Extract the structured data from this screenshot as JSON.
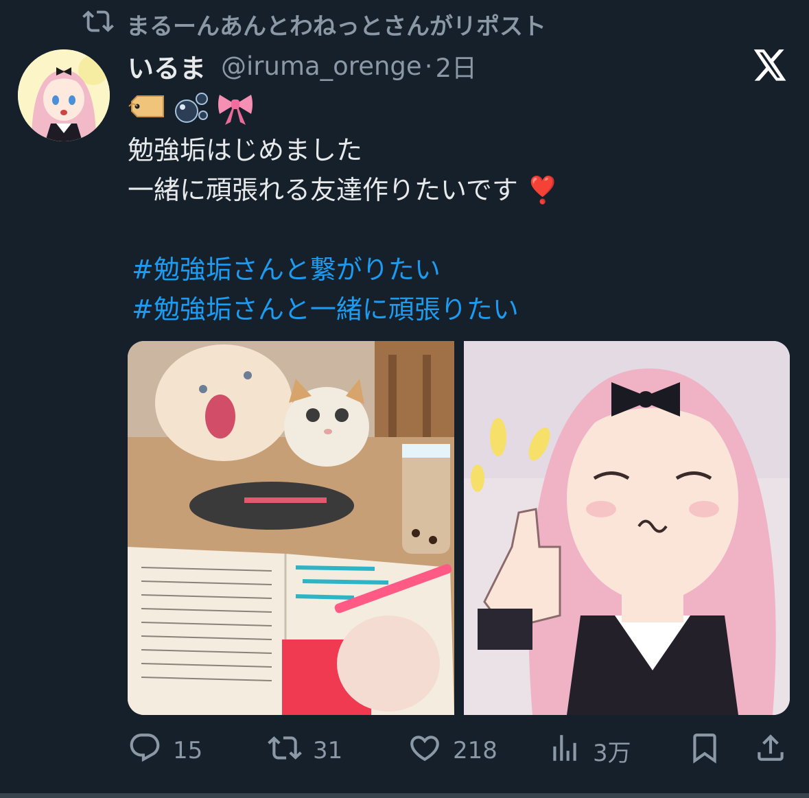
{
  "repost": {
    "icon": "repost-icon",
    "text": "まるーんあんとわねっとさんがリポスト"
  },
  "tweet": {
    "display_name": "いるま",
    "handle": "@iruma_orenge",
    "separator": "·",
    "time": "2日",
    "emojis": [
      "label-tag-emoji",
      "bubbles-emoji",
      "ribbon-emoji"
    ],
    "lines": [
      "勉強垢はじめました",
      "一緒に頑張れる友達作りたいです ❣️"
    ],
    "hashtags": [
      "#勉強垢さんと繋がりたい",
      "#勉強垢さんと一緒に頑張りたい"
    ]
  },
  "media": {
    "images": [
      "study-desk-cats-photo",
      "anime-girl-thumbs-up-image"
    ]
  },
  "actions": {
    "reply": {
      "icon": "reply-icon",
      "count": "15"
    },
    "repost": {
      "icon": "repost-icon",
      "count": "31"
    },
    "like": {
      "icon": "heart-icon",
      "count": "218"
    },
    "views": {
      "icon": "views-icon",
      "count": "3万"
    },
    "bookmark": {
      "icon": "bookmark-icon"
    },
    "share": {
      "icon": "share-icon"
    }
  },
  "colors": {
    "background": "#15202b",
    "text": "#e7e9ea",
    "secondary": "#8b98a5",
    "link": "#1d9bf0"
  }
}
